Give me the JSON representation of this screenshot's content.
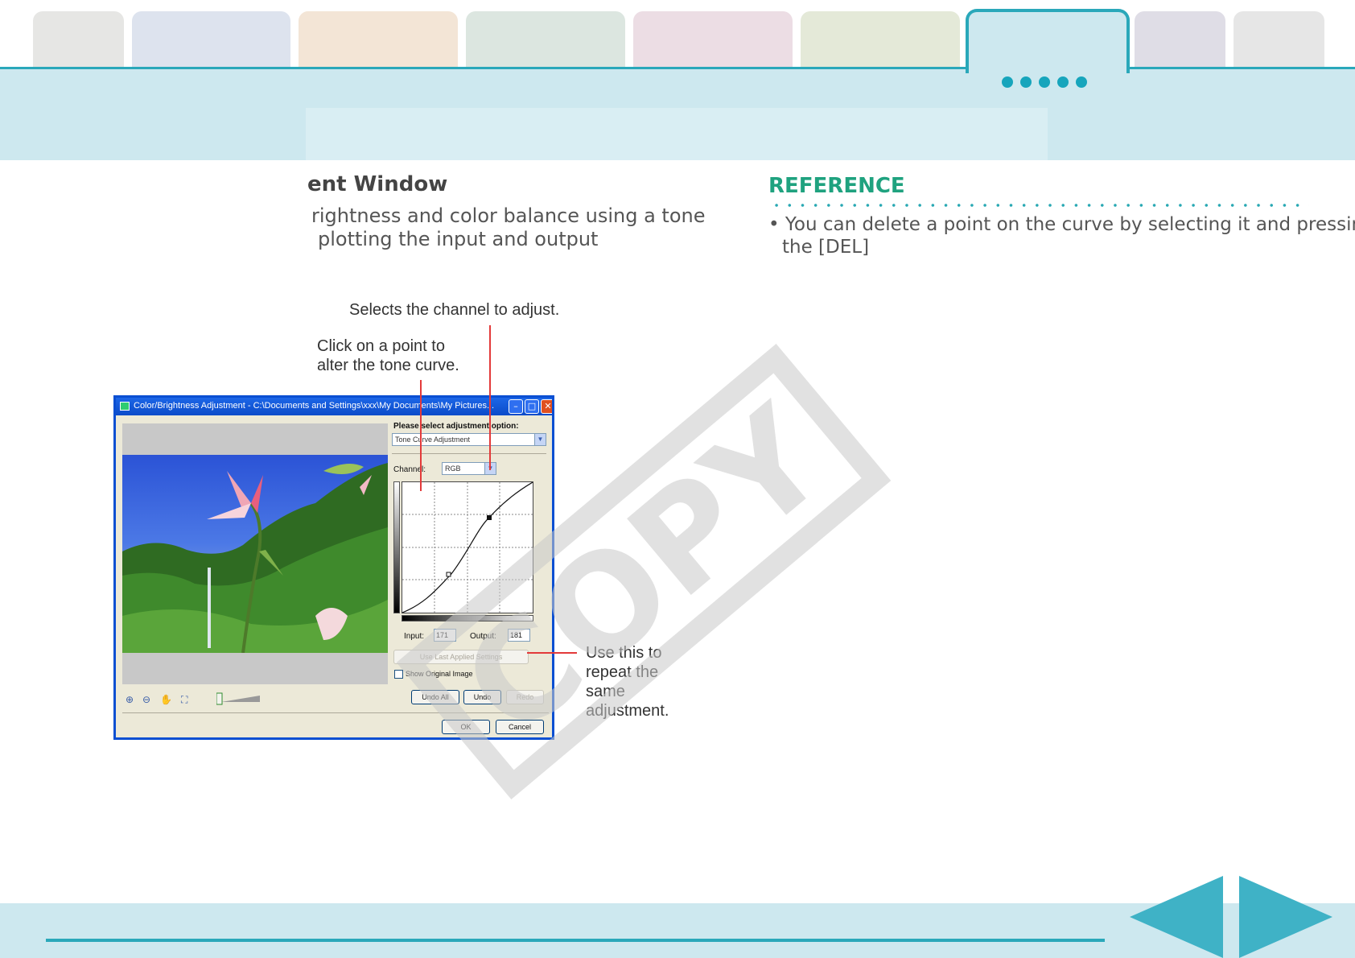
{
  "header": {
    "tab_colors": [
      "#e6e6e4",
      "#dde3ee",
      "#f3e5d6",
      "#dce6e0",
      "#ecdde4",
      "#e4e9d8",
      "#cde8ef",
      "#dfdde6",
      "#e6e6e6"
    ],
    "accent": "#2aa8ba",
    "band_color": "#cde8ef"
  },
  "main": {
    "heading": "ent Window",
    "body_lines": [
      "rightness and color balance using a tone",
      "plotting the input and output"
    ]
  },
  "reference": {
    "title": "REFERENCE",
    "title_color": "#1fa27f",
    "line1": "• You can delete a point on the curve by selecting it and pressing",
    "line2": "the [DEL]"
  },
  "callouts": {
    "channel": "Selects the channel to adjust.",
    "curve_line1": "Click on a point to",
    "curve_line2": "alter the tone curve.",
    "repeat_lines": [
      "Use this to",
      "repeat the",
      "same",
      "adjustment."
    ],
    "line_color": "#e33a3a"
  },
  "dialog": {
    "title": "Color/Brightness Adjustment - C:\\Documents and Settings\\xxx\\My Documents\\My Pictures...",
    "option_label": "Please select adjustment option:",
    "option_value": "Tone Curve Adjustment",
    "channel_label": "Channel:",
    "channel_value": "RGB",
    "input_label": "Input:",
    "input_value": "171",
    "output_label": "Output:",
    "output_value": "181",
    "use_last_button": "Use Last Applied Settings",
    "show_original_label": "Show Original Image",
    "undo_all_button": "Undo All",
    "undo_button": "Undo",
    "redo_button": "Redo",
    "ok_button": "OK",
    "cancel_button": "Cancel",
    "icons": [
      "zoom-in-icon",
      "zoom-out-icon",
      "hand-icon",
      "fit-icon"
    ]
  },
  "watermark": {
    "text": "COPY",
    "color": "#d6d6d6"
  },
  "footer": {
    "prev_color": "#3fb2c6",
    "next_color": "#3fb2c6"
  }
}
